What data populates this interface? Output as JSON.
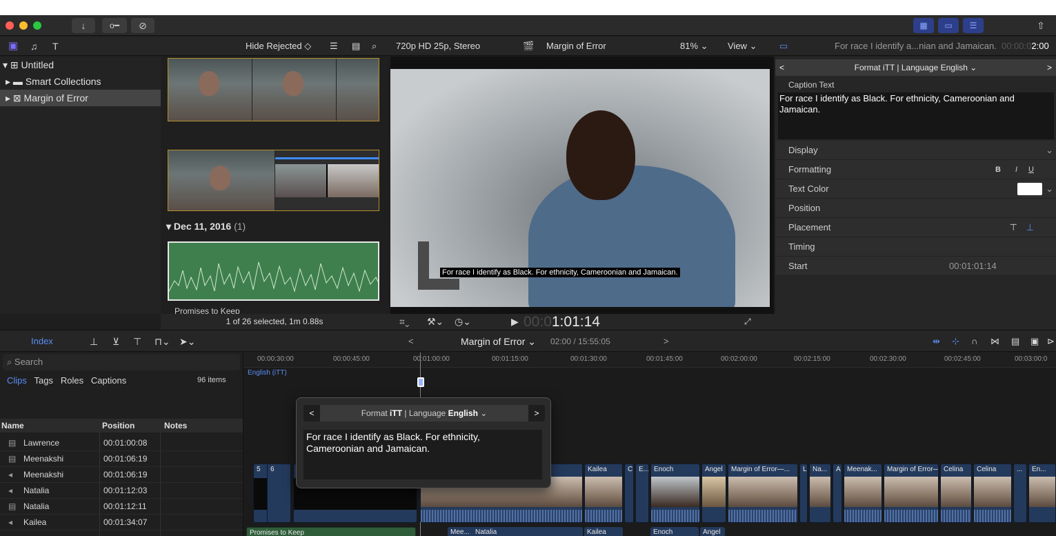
{
  "colors": {
    "accent": "#3d8bfd",
    "selection": "#b58f2e",
    "clip_blue": "#243a5c",
    "audio_green": "#3f7f4d",
    "link_blue": "#5a8ef5"
  },
  "toolbar": {
    "import_icon": "download-icon",
    "keys_icon": "key-icon",
    "check_icon": "checkmark-circle-icon"
  },
  "browser": {
    "filter": "Hide Rejected ◇",
    "date_group": "Dec 11, 2016",
    "date_count": "(1)",
    "audio_clip_label": "Promises to Keep",
    "status": "1 of 26 selected, 1m 0.88s"
  },
  "libraries": {
    "items": [
      {
        "label": "Untitled",
        "icon": "library-grid-icon"
      },
      {
        "label": "Smart Collections",
        "icon": "folder-icon"
      },
      {
        "label": "Margin of Error",
        "icon": "event-star-icon"
      }
    ]
  },
  "viewer": {
    "format": "720p HD 25p, Stereo",
    "project": "Margin of Error",
    "zoom": "81%",
    "view_menu": "View",
    "caption": "For race I identify as Black. For ethnicity, Cameroonian and Jamaican.",
    "timecode_dim": "00:0",
    "timecode": "1:01:14"
  },
  "inspector": {
    "title": "For race I identify a...nian and Jamaican.",
    "title_timecode_dim": "00:00:0",
    "title_timecode": "2:00",
    "format_bar": "Format iTT | Language English",
    "caption_text_label": "Caption Text",
    "caption_text": "For race I identify as Black. For ethnicity, Cameroonian and Jamaican.",
    "rows": [
      {
        "label": "Display"
      },
      {
        "label": "Formatting"
      },
      {
        "label": "Text Color"
      },
      {
        "label": "Position"
      },
      {
        "label": "Placement"
      },
      {
        "label": "Timing"
      },
      {
        "label": "Start",
        "value": "00:01:01:14"
      }
    ],
    "formatting_buttons": [
      "B",
      "I",
      "U"
    ]
  },
  "timeline_bar": {
    "index_label": "Index",
    "project": "Margin of Error",
    "duration": "02:00 / 15:55:05"
  },
  "index": {
    "search_placeholder": "Search",
    "tabs": [
      "Clips",
      "Tags",
      "Roles",
      "Captions"
    ],
    "item_count": "96 items",
    "columns": [
      "Name",
      "Position",
      "Notes"
    ],
    "rows": [
      {
        "icon": "film-icon",
        "name": "Lawrence",
        "position": "00:01:00:08"
      },
      {
        "icon": "film-icon",
        "name": "Meenakshi",
        "position": "00:01:06:19"
      },
      {
        "icon": "audio-icon",
        "name": "Meenakshi",
        "position": "00:01:06:19"
      },
      {
        "icon": "audio-icon",
        "name": "Natalia",
        "position": "00:01:12:03"
      },
      {
        "icon": "film-icon",
        "name": "Natalia",
        "position": "00:01:12:11"
      },
      {
        "icon": "audio-icon",
        "name": "Kailea",
        "position": "00:01:34:07"
      }
    ]
  },
  "timeline": {
    "ruler": [
      "00:00:30:00",
      "00:00:45:00",
      "00:01:00:00",
      "00:01:15:00",
      "00:01:30:00",
      "00:01:45:00",
      "00:02:00:00",
      "00:02:15:00",
      "00:02:30:00",
      "00:02:45:00",
      "00:03:00:0"
    ],
    "caption_lane": "English (iTT)",
    "clips": [
      "5",
      "6",
      "Kailea",
      "C",
      "E...",
      "Enoch",
      "Angel",
      "Margin of Error—...",
      "L",
      "Na...",
      "A",
      "Meenak...",
      "Margin of Error—P...",
      "Celina",
      "Celina",
      "...",
      "En..."
    ],
    "audio_clips": [
      "Promises to Keep",
      "Mee...",
      "Natalia",
      "Kailea",
      "Enoch",
      "Angel"
    ]
  },
  "popover": {
    "format_prefix": "Format ",
    "format_bold": "iTT",
    "language_prefix": " | Language ",
    "language_bold": "English",
    "text": "For race I identify as Black. For ethnicity, Cameroonian and Jamaican."
  }
}
